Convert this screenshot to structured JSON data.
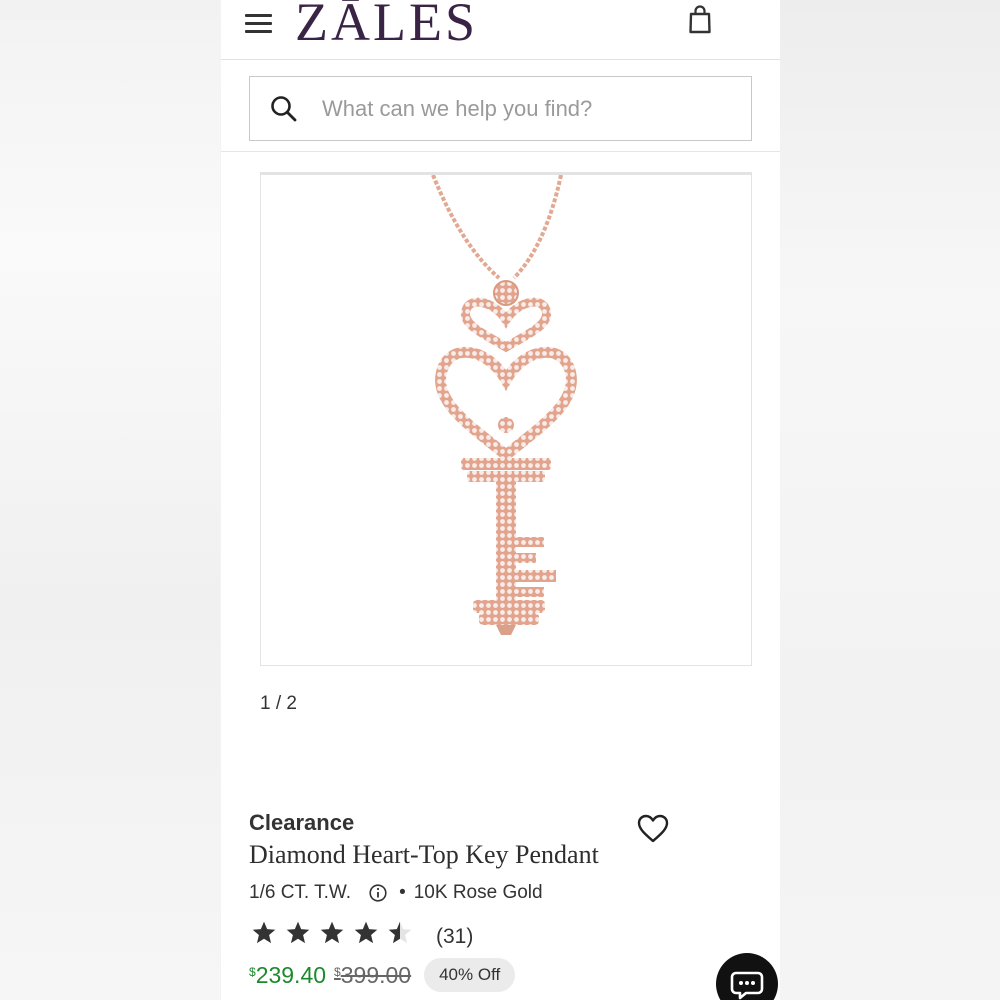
{
  "header": {
    "logo_text": "ZĀLES",
    "menu_icon": "hamburger-icon",
    "bag_icon": "shopping-bag-icon",
    "brand_color": "#3a2446"
  },
  "search": {
    "placeholder": "What can we help you find?",
    "icon": "search-icon"
  },
  "gallery": {
    "pager": "1 / 2",
    "image_alt_icon": "key-pendant-image"
  },
  "product": {
    "tag": "Clearance",
    "title": "Diamond Heart-Top Key Pendant",
    "carat": "1/6 CT. T.W.",
    "separator": "•",
    "metal": "10K Rose Gold",
    "rating": 4.5,
    "rating_max": 5,
    "reviews": "(31)",
    "currency_symbol": "$",
    "sale_price": "239.40",
    "original_price": "399.00",
    "discount": "40% Off",
    "sale_color": "#1c8a2c"
  },
  "chat": {
    "icon": "chat-icon"
  }
}
